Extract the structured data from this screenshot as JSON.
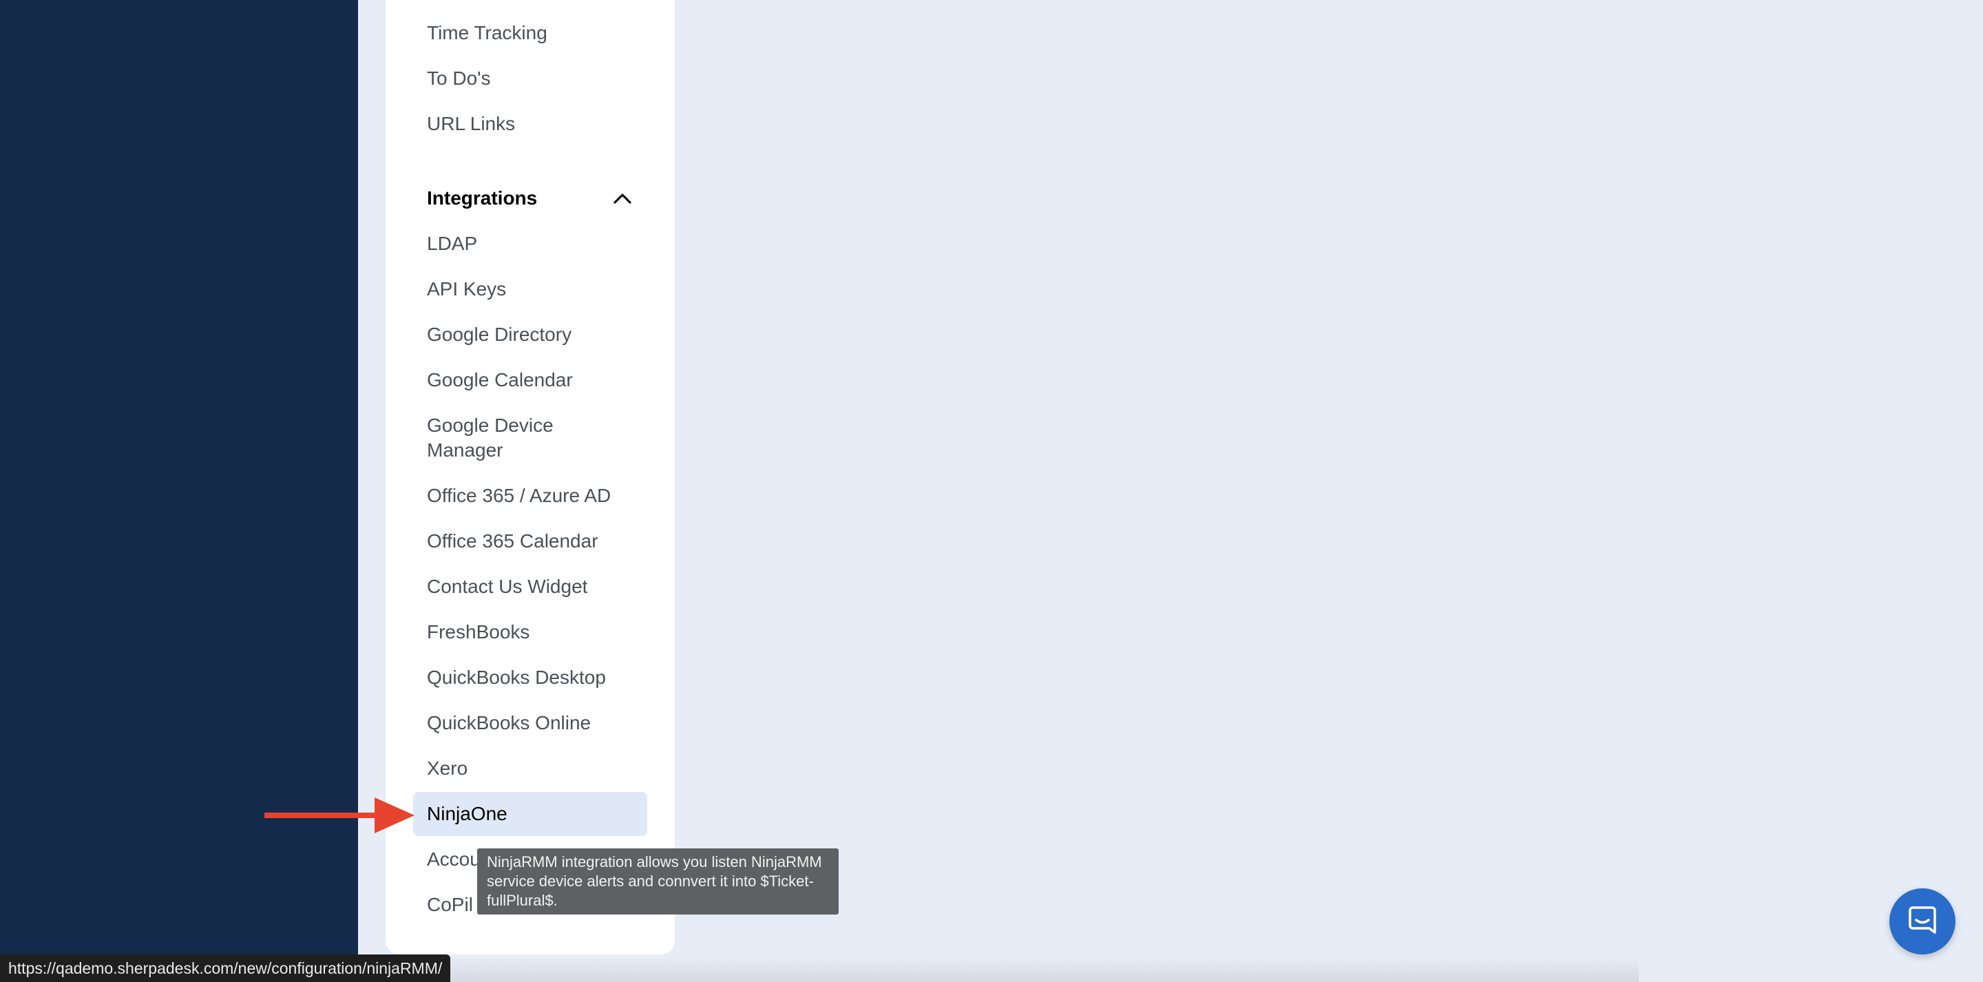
{
  "menu": {
    "top_items": [
      {
        "label": "Time Tracking"
      },
      {
        "label": "To Do's"
      },
      {
        "label": "URL Links"
      }
    ],
    "integrations": {
      "title": "Integrations",
      "items": [
        {
          "label": "LDAP"
        },
        {
          "label": "API Keys"
        },
        {
          "label": "Google Directory"
        },
        {
          "label": "Google Calendar"
        },
        {
          "label": "Google Device Manager"
        },
        {
          "label": "Office 365 / Azure AD"
        },
        {
          "label": "Office 365 Calendar"
        },
        {
          "label": "Contact Us Widget"
        },
        {
          "label": "FreshBooks"
        },
        {
          "label": "QuickBooks Desktop"
        },
        {
          "label": "QuickBooks Online"
        },
        {
          "label": "Xero"
        },
        {
          "label": "NinjaOne"
        },
        {
          "label": "Accou"
        },
        {
          "label": "CoPil"
        }
      ],
      "active_item": "NinjaOne"
    }
  },
  "tooltip": {
    "text": "NinjaRMM integration allows you listen NinjaRMM service device alerts and connvert it into $Ticket-fullPlural$."
  },
  "status_bar": {
    "url": "https://qademo.sherpadesk.com/new/configuration/ninjaRMM/"
  },
  "icons": {
    "chevron": "chevron-up-icon",
    "annotation": "red-arrow-icon",
    "chat": "chat-bubble-icon"
  },
  "colors": {
    "sidebar": "#142a4b",
    "background": "#e7edf6",
    "panel": "#ffffff",
    "active_item": "#dfe8f6",
    "arrow": "#e8432e",
    "chat_button": "#2a6cc9",
    "tooltip": "#5f6063"
  }
}
